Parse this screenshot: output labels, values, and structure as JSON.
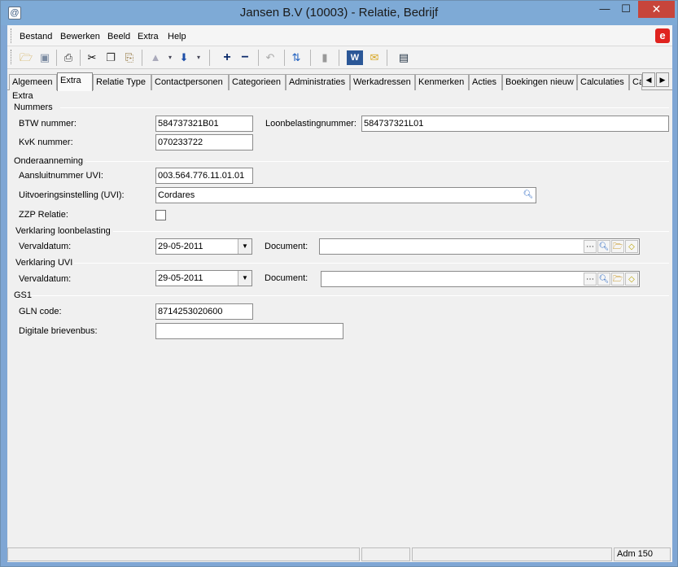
{
  "window": {
    "title": "Jansen B.V (10003) - Relatie, Bedrijf",
    "minimize_glyph": "—",
    "maximize_glyph": "☐",
    "close_glyph": "✕"
  },
  "menu": {
    "items": [
      "Bestand",
      "Bewerken",
      "Beeld",
      "Extra",
      "Help"
    ]
  },
  "toolbar": {
    "icons": [
      "open-folder-icon",
      "save-icon",
      "print-icon",
      "cut-icon",
      "copy-icon",
      "paste-icon",
      "up-icon",
      "down-icon",
      "add-icon",
      "remove-icon",
      "undo-icon",
      "refresh-icon",
      "bookmark-icon",
      "word-icon",
      "mail-icon",
      "table-icon"
    ]
  },
  "tabs": [
    "Algemeen",
    "Extra",
    "Relatie Type",
    "Contactpersonen",
    "Categorieen",
    "Administraties",
    "Werkadressen",
    "Kenmerken",
    "Acties",
    "Boekingen nieuw",
    "Calculaties",
    "Ca"
  ],
  "active_tab": "Extra",
  "form": {
    "header": "Extra",
    "sections": {
      "nummers": "Nummers",
      "onderaanneming": "Onderaanneming",
      "verklaring_loon": "Verklaring loonbelasting",
      "verklaring_uvi": "Verklaring UVI",
      "gs1": "GS1"
    },
    "btw_label": "BTW nummer:",
    "btw_value": "584737321B01",
    "loonbelasting_label": "Loonbelastingnummer:",
    "loonbelasting_value": "584737321L01",
    "kvk_label": "KvK nummer:",
    "kvk_value": "070233722",
    "aansluit_label": "Aansluitnummer UVI:",
    "aansluit_value": "003.564.776.11.01.01",
    "uitvoering_label": "Uitvoeringsinstelling (UVI):",
    "uitvoering_value": "Cordares",
    "zzp_label": "ZZP Relatie:",
    "zzp_checked": false,
    "loon_vervaldatum_label": "Vervaldatum:",
    "loon_vervaldatum_value": "29-05-2011",
    "loon_document_label": "Document:",
    "loon_document_value": "",
    "uvi_vervaldatum_label": "Vervaldatum:",
    "uvi_vervaldatum_value": "29-05-2011",
    "uvi_document_label": "Document:",
    "uvi_document_value": "",
    "gln_label": "GLN code:",
    "gln_value": "8714253020600",
    "brievenbus_label": "Digitale brievenbus:",
    "brievenbus_value": ""
  },
  "status": {
    "adm": "Adm 150"
  },
  "colors": {
    "titlebar": "#7eaad6",
    "close_button": "#c7453b",
    "brand": "#e0231f"
  }
}
